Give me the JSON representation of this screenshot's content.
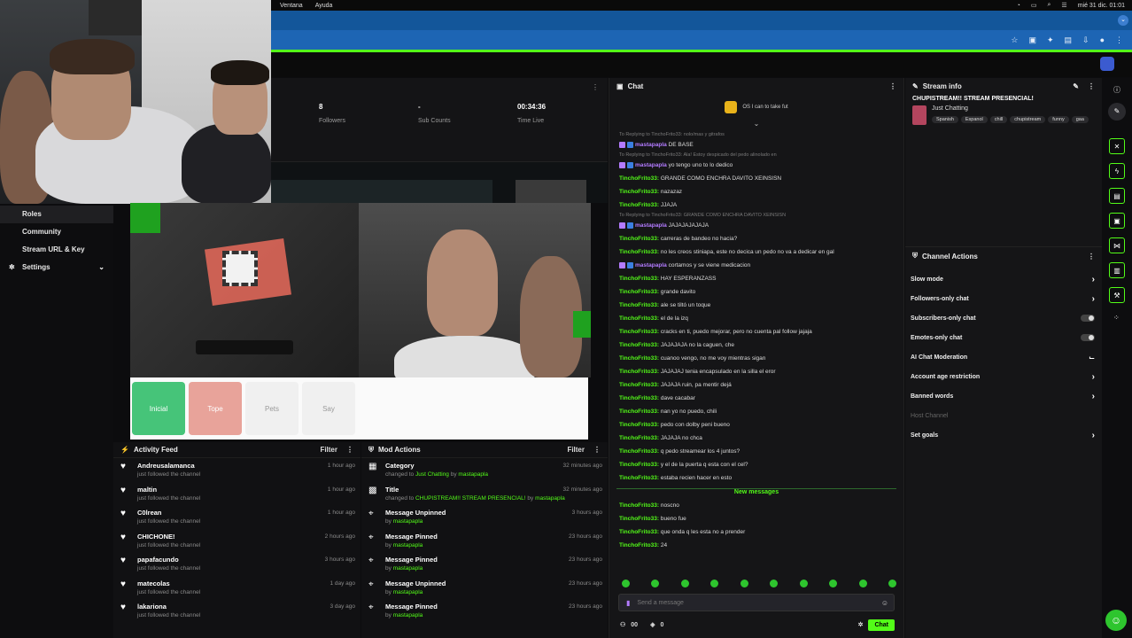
{
  "menubar": {
    "items": [
      "Ventana",
      "Ayuda"
    ],
    "clock": "mié 31 dic. 01:01"
  },
  "stats": [
    {
      "value": "8",
      "label": "Followers"
    },
    {
      "value": "-",
      "label": "Sub Counts"
    },
    {
      "value": "00:34:36",
      "label": "Time Live"
    }
  ],
  "sidebar": {
    "items": [
      "Roles",
      "Community",
      "Stream URL & Key",
      "Settings"
    ]
  },
  "poll": {
    "buttons": [
      "Inicial",
      "Tope",
      "Pets",
      "Say"
    ]
  },
  "activity": {
    "title": "Activity Feed",
    "filter": "Filter",
    "items": [
      {
        "name": "Andreusalamanca",
        "sub": "just followed the channel",
        "time": "1 hour ago"
      },
      {
        "name": "maltin",
        "sub": "just followed the channel",
        "time": "1 hour ago"
      },
      {
        "name": "C0lrean",
        "sub": "just followed the channel",
        "time": "1 hour ago"
      },
      {
        "name": "CHICHONE!",
        "sub": "just followed the channel",
        "time": "2 hours ago"
      },
      {
        "name": "papafacundo",
        "sub": "just followed the channel",
        "time": "3 hours ago"
      },
      {
        "name": "matecolas",
        "sub": "just followed the channel",
        "time": "1 day ago"
      },
      {
        "name": "lakariona",
        "sub": "just followed the channel",
        "time": "3 day ago"
      }
    ]
  },
  "mod": {
    "title": "Mod Actions",
    "filter": "Filter",
    "items": [
      {
        "name": "Category",
        "sub_pre": "changed to",
        "sub_hl": "Just Chatting",
        "sub_by": "by",
        "user": "mastapapla",
        "time": "32 minutes ago"
      },
      {
        "name": "Title",
        "sub_pre": "changed to",
        "sub_hl": "CHUPISTREAM!! STREAM PRESENCIAL!",
        "sub_by": "by",
        "user": "mastapapla",
        "time": "32 minutes ago"
      },
      {
        "name": "Message Unpinned",
        "sub_pre": "by",
        "sub_hl": "",
        "sub_by": "",
        "user": "mastapapla",
        "time": "3 hours ago"
      },
      {
        "name": "Message Pinned",
        "sub_pre": "by",
        "sub_hl": "",
        "sub_by": "",
        "user": "mastapapla",
        "time": "23 hours ago"
      },
      {
        "name": "Message Pinned",
        "sub_pre": "by",
        "sub_hl": "",
        "sub_by": "",
        "user": "mastapapla",
        "time": "23 hours ago"
      },
      {
        "name": "Message Unpinned",
        "sub_pre": "by",
        "sub_hl": "",
        "sub_by": "",
        "user": "mastapapla",
        "time": "23 hours ago"
      },
      {
        "name": "Message Pinned",
        "sub_pre": "by",
        "sub_hl": "",
        "sub_by": "",
        "user": "mastapapla",
        "time": "23 hours ago"
      }
    ]
  },
  "chat": {
    "title": "Chat",
    "pinned": "OS I can to take fut",
    "messages": [
      {
        "reply": "To Replying to TinchoFrito33: nolo/mas y gitrafos",
        "user": "mastapapla",
        "text": "DE BASE",
        "mod": true
      },
      {
        "reply": "To Replying to TinchoFrito33: Ala! Estoy despicado del pedo alinolado en",
        "user": "mastapapla",
        "text": "yo tengo uno to lo dedico",
        "mod": true
      },
      {
        "reply": "",
        "user": "TinchoFrito33:",
        "text": "GRANDE COMO ENCHRA DAVITO XEINSISN",
        "mod": false
      },
      {
        "reply": "",
        "user": "TinchoFrito33:",
        "text": "nazazaz",
        "mod": false
      },
      {
        "reply": "",
        "user": "TinchoFrito33:",
        "text": "JJAJA",
        "mod": false
      },
      {
        "reply": "To Replying to TinchoFrito33: GRANDE COMO ENCHRA DAVITO XEINSISN",
        "user": "mastapapla",
        "text": "JAJAJAJAJAJA",
        "mod": true
      },
      {
        "reply": "",
        "user": "TinchoFrito33:",
        "text": "carreras de bandeo no hacia?",
        "mod": false
      },
      {
        "reply": "",
        "user": "TinchoFrito33:",
        "text": "no les creos stiniapa, este no decica un pedo no va a dedicar en gal",
        "mod": false
      },
      {
        "reply": "",
        "user": "mastapapla",
        "text": "cortamos y se viene medicacion",
        "mod": true
      },
      {
        "reply": "",
        "user": "TinchoFrito33:",
        "text": "HAY ESPERANZASS",
        "mod": false
      },
      {
        "reply": "",
        "user": "TinchoFrito33:",
        "text": "grande davito",
        "mod": false
      },
      {
        "reply": "",
        "user": "TinchoFrito33:",
        "text": "ale se tiltó un toque",
        "mod": false
      },
      {
        "reply": "",
        "user": "TinchoFrito33:",
        "text": "el de la izq",
        "mod": false
      },
      {
        "reply": "",
        "user": "TinchoFrito33:",
        "text": "cracks en ti, puedo mejorar, pero no cuenta pal follow jajaja",
        "mod": false
      },
      {
        "reply": "",
        "user": "TinchoFrito33:",
        "text": "JAJAJAJA no la caguen, che",
        "mod": false
      },
      {
        "reply": "",
        "user": "TinchoFrito33:",
        "text": "cuanoo vengo, no me voy mientras sigan",
        "mod": false
      },
      {
        "reply": "",
        "user": "TinchoFrito33:",
        "text": "JAJAJAJ tenia encapsulado en la silla el eror",
        "mod": false
      },
      {
        "reply": "",
        "user": "TinchoFrito33:",
        "text": "JAJAJA ruin, pa mentir dejá",
        "mod": false
      },
      {
        "reply": "",
        "user": "TinchoFrito33:",
        "text": "dave cacabar",
        "mod": false
      },
      {
        "reply": "",
        "user": "TinchoFrito33:",
        "text": "nan yo no puedo, chili",
        "mod": false
      },
      {
        "reply": "",
        "user": "TinchoFrito33:",
        "text": "pedo con dolby peni bueno",
        "mod": false
      },
      {
        "reply": "",
        "user": "TinchoFrito33:",
        "text": "JAJAJA no chca",
        "mod": false
      },
      {
        "reply": "",
        "user": "TinchoFrito33:",
        "text": "q pedo streamear los 4 juntos?",
        "mod": false
      },
      {
        "reply": "",
        "user": "TinchoFrito33:",
        "text": "y el de la puerta q esta con el cel?",
        "mod": false
      },
      {
        "reply": "",
        "user": "TinchoFrito33:",
        "text": "estaba recien hacer en esto",
        "mod": false
      }
    ],
    "new_label": "New messages",
    "new_messages": [
      {
        "user": "TinchoFrito33:",
        "text": "noscno"
      },
      {
        "user": "TinchoFrito33:",
        "text": "bueno fue"
      },
      {
        "user": "TinchoFrito33:",
        "text": "que onda q les esta no a prender"
      },
      {
        "user": "TinchoFrito33:",
        "text": "24"
      }
    ],
    "input_placeholder": "Send a message",
    "viewers": "00",
    "count": "0",
    "send": "Chat"
  },
  "streaminfo": {
    "title": "Stream info",
    "stream_title": "CHUPISTREAM!! STREAM PRESENCIAL!",
    "category": "Just Chatting",
    "tags": [
      "Spanish",
      "Espanol",
      "chill",
      "chupistream",
      "funny",
      "gaa"
    ]
  },
  "actions": {
    "title": "Channel Actions",
    "items": [
      {
        "label": "Slow mode",
        "kind": "arrow"
      },
      {
        "label": "Followers-only chat",
        "kind": "arrow"
      },
      {
        "label": "Subscribers-only chat",
        "kind": "toggle"
      },
      {
        "label": "Emotes-only chat",
        "kind": "toggle"
      },
      {
        "label": "AI Chat Moderation",
        "kind": "ext"
      },
      {
        "label": "Account age restriction",
        "kind": "arrow"
      },
      {
        "label": "Banned words",
        "kind": "arrow"
      },
      {
        "label": "Host Channel",
        "kind": "muted"
      },
      {
        "label": "Set goals",
        "kind": "arrow"
      }
    ]
  },
  "colors": {
    "accent": "#53fc18",
    "mod_user": "#b37bff",
    "browser_blue": "#1d65b4"
  }
}
